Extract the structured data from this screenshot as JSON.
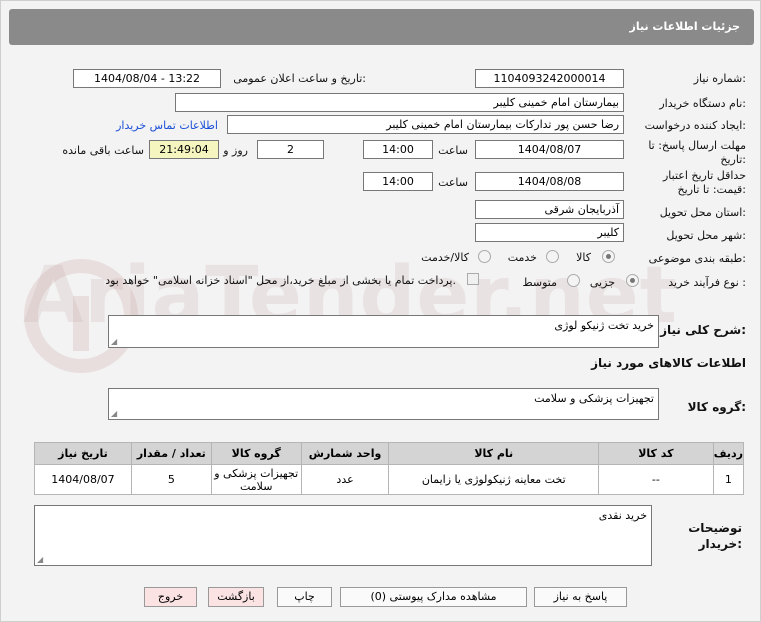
{
  "page_title": "جزئیات اطلاعات نیاز",
  "need_number": {
    "label": "شماره نیاز:",
    "value": "1104093242000014"
  },
  "announce_datetime": {
    "label": "تاریخ و ساعت اعلان عمومی:",
    "value": "1404/08/04 - 13:22"
  },
  "buyer_org": {
    "label": "نام دستگاه خریدار:",
    "value": "بیمارستان امام خمینی کلیبر"
  },
  "requester": {
    "label": "ایجاد کننده درخواست:",
    "value": "رضا حسن پور تدارکات بیمارستان امام خمینی کلیبر",
    "contact_link": "اطلاعات تماس خریدار"
  },
  "reply_deadline": {
    "label_line1": "مهلت ارسال پاسخ: تا",
    "label_line2": "تاریخ:",
    "date": "1404/08/07",
    "time_label": "ساعت",
    "time": "14:00",
    "days": "2",
    "days_label": "روز و",
    "remaining": "21:49:04",
    "remaining_label": "ساعت باقی مانده"
  },
  "price_validity": {
    "label_line1": "حداقل تاریخ اعتبار",
    "label_line2": "قیمت: تا تاریخ:",
    "date": "1404/08/08",
    "time_label": "ساعت",
    "time": "14:00"
  },
  "delivery_province": {
    "label": "استان محل تحویل:",
    "value": "آذربایجان شرقی"
  },
  "delivery_city": {
    "label": "شهر محل تحویل:",
    "value": "کلیبر"
  },
  "category": {
    "label": "طبقه بندی موضوعی:",
    "options": [
      "کالا",
      "خدمت",
      "کالا/خدمت"
    ],
    "selected": "کالا"
  },
  "purchase_type": {
    "label": "نوع فرآیند خرید :",
    "options": [
      "جزیی",
      "متوسط"
    ],
    "selected": "جزیی",
    "treasury_note": "پرداخت تمام یا بخشی از مبلغ خرید،از محل \"اسناد خزانه اسلامی\" خواهد بود."
  },
  "general_description": {
    "label": "شرح کلی نیاز:",
    "value": "خرید تخت ژنیکو لوژی"
  },
  "goods_info_heading": "اطلاعات کالاهای مورد نیاز",
  "goods_group": {
    "label": "گروه کالا:",
    "value": "تجهیزات پزشکی و سلامت"
  },
  "table": {
    "headers": [
      "ردیف",
      "کد کالا",
      "نام کالا",
      "واحد شمارش",
      "گروه کالا",
      "تعداد / مقدار",
      "تاریخ نیاز"
    ],
    "rows": [
      [
        "1",
        "--",
        "تخت معاینه ژنیکولوژی یا زایمان",
        "عدد",
        "تجهیزات پزشکی و سلامت",
        "5",
        "1404/08/07"
      ]
    ]
  },
  "buyer_notes": {
    "label_line1": "توضیحات",
    "label_line2": "خریدار:",
    "value": "خرید نقدی"
  },
  "buttons": {
    "reply": "پاسخ به نیاز",
    "attachments": "مشاهده مدارک پیوستی (0)",
    "print": "چاپ",
    "back": "بازگشت",
    "exit": "خروج"
  },
  "watermark": "AriaTender.net"
}
